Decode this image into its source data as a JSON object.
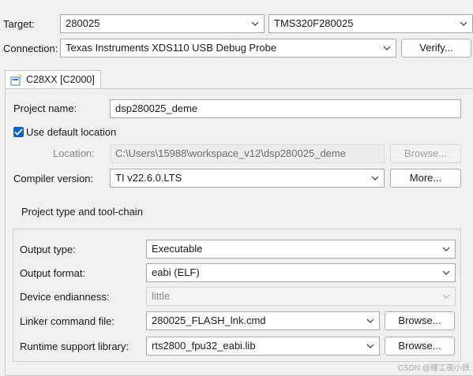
{
  "target": {
    "label": "Target:",
    "family_value": "280025",
    "device_value": "TMS320F280025"
  },
  "connection": {
    "label": "Connection:",
    "value": "Texas Instruments XDS110 USB Debug Probe",
    "verify_label": "Verify..."
  },
  "tab": {
    "label": "C28XX [C2000]",
    "icon": "cpu-tab-icon"
  },
  "project": {
    "name_label": "Project name:",
    "name_value": "dsp280025_deme",
    "use_default_label": "Use default location",
    "use_default_checked": true,
    "location_label": "Location:",
    "location_value": "C:\\Users\\15988\\workspace_v12\\dsp280025_deme",
    "browse_label": "Browse...",
    "compiler_label": "Compiler version:",
    "compiler_value": "TI v22.6.0.LTS",
    "more_label": "More..."
  },
  "toolchain": {
    "title": "Project type and tool-chain",
    "output_type_label": "Output type:",
    "output_type_value": "Executable",
    "output_format_label": "Output format:",
    "output_format_value": "eabi (ELF)",
    "endianness_label": "Device endianness:",
    "endianness_value": "little",
    "linker_label": "Linker command file:",
    "linker_value": "280025_FLASH_lnk.cmd",
    "linker_browse_label": "Browse...",
    "runtime_label": "Runtime support library:",
    "runtime_value": "rts2800_fpu32_eabi.lib",
    "runtime_browse_label": "Browse..."
  },
  "watermark": "CSDN @理工夜小妖",
  "colors": {
    "accent": "#0a62c4",
    "background": "#f0f0f0",
    "border": "#a9a9a9"
  }
}
